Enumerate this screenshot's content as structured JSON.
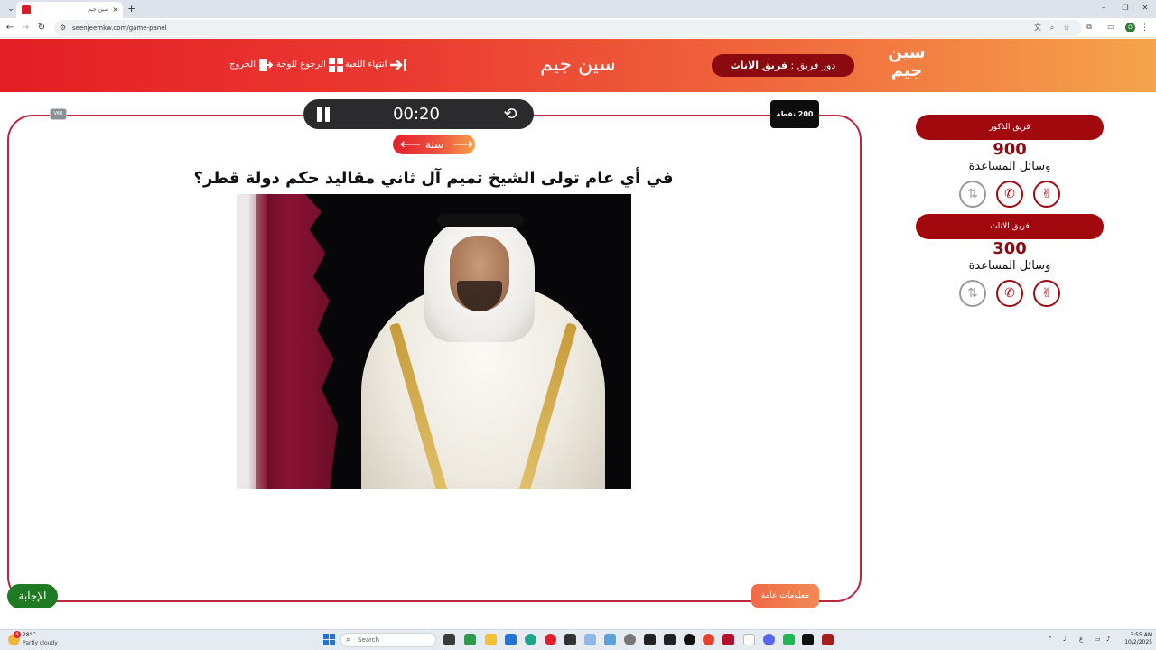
{
  "browser": {
    "tab_title": "سين جيم",
    "new_tab": "+",
    "tab_close": "×",
    "url": "seenjeemkw.com/game-panel",
    "window_controls": [
      "–",
      "❐",
      "✕"
    ]
  },
  "header": {
    "title": "سين جيم",
    "logo_text": [
      "سين",
      "جيم"
    ],
    "actions": {
      "exit": "الخروج",
      "back_to_board": "الرجوع للوحة",
      "end_game": "انتهاء اللعبة"
    },
    "turn_label": "دور فريق :",
    "turn_team": "فريق الاناث"
  },
  "game": {
    "var_badge": "VAR",
    "timer": "00:20",
    "points": "200 نقطة",
    "answer_type": "سنة",
    "question": "في أي عام تولى الشيخ تميم آل ثاني مقاليد حكم دولة قطر؟",
    "general_info_button": "معلومات عامة",
    "answer_button": "الإجابة"
  },
  "teams": [
    {
      "name": "فريق الذكور",
      "score": "900",
      "aids_label": "وسائل المساعدة",
      "aids": [
        {
          "icon": "two-answers-icon",
          "state": "used"
        },
        {
          "icon": "phone-icon",
          "state": "active"
        },
        {
          "icon": "hand-icon",
          "state": "active"
        }
      ]
    },
    {
      "name": "فريق الاناث",
      "score": "300",
      "aids_label": "وسائل المساعدة",
      "aids": [
        {
          "icon": "two-answers-icon",
          "state": "used"
        },
        {
          "icon": "phone-icon",
          "state": "active"
        },
        {
          "icon": "hand-icon",
          "state": "active"
        }
      ]
    }
  ],
  "taskbar": {
    "weather_badge": "4",
    "weather_temp": "28°C",
    "weather_desc": "Partly cloudy",
    "search_placeholder": "Search",
    "time": "3:55 AM",
    "date": "10/2/2025"
  },
  "colors": {
    "brand_red": "#e41e26",
    "dark_red": "#a1090f",
    "panel_border": "#c0243e",
    "answer_green": "#1e7a23",
    "header_gradient_end": "#f5a44c"
  }
}
